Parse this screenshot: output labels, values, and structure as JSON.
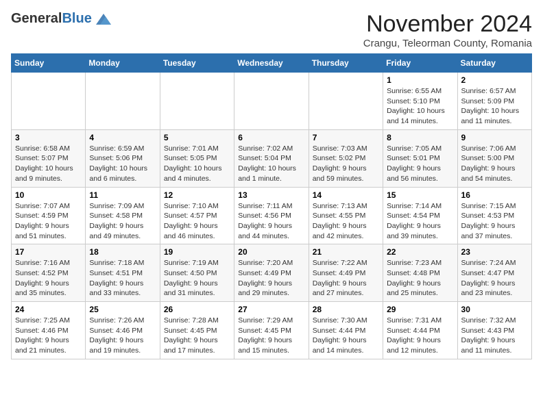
{
  "header": {
    "logo_general": "General",
    "logo_blue": "Blue",
    "month_title": "November 2024",
    "location": "Crangu, Teleorman County, Romania"
  },
  "days_of_week": [
    "Sunday",
    "Monday",
    "Tuesday",
    "Wednesday",
    "Thursday",
    "Friday",
    "Saturday"
  ],
  "weeks": [
    [
      {
        "day": "",
        "info": ""
      },
      {
        "day": "",
        "info": ""
      },
      {
        "day": "",
        "info": ""
      },
      {
        "day": "",
        "info": ""
      },
      {
        "day": "",
        "info": ""
      },
      {
        "day": "1",
        "info": "Sunrise: 6:55 AM\nSunset: 5:10 PM\nDaylight: 10 hours and 14 minutes."
      },
      {
        "day": "2",
        "info": "Sunrise: 6:57 AM\nSunset: 5:09 PM\nDaylight: 10 hours and 11 minutes."
      }
    ],
    [
      {
        "day": "3",
        "info": "Sunrise: 6:58 AM\nSunset: 5:07 PM\nDaylight: 10 hours and 9 minutes."
      },
      {
        "day": "4",
        "info": "Sunrise: 6:59 AM\nSunset: 5:06 PM\nDaylight: 10 hours and 6 minutes."
      },
      {
        "day": "5",
        "info": "Sunrise: 7:01 AM\nSunset: 5:05 PM\nDaylight: 10 hours and 4 minutes."
      },
      {
        "day": "6",
        "info": "Sunrise: 7:02 AM\nSunset: 5:04 PM\nDaylight: 10 hours and 1 minute."
      },
      {
        "day": "7",
        "info": "Sunrise: 7:03 AM\nSunset: 5:02 PM\nDaylight: 9 hours and 59 minutes."
      },
      {
        "day": "8",
        "info": "Sunrise: 7:05 AM\nSunset: 5:01 PM\nDaylight: 9 hours and 56 minutes."
      },
      {
        "day": "9",
        "info": "Sunrise: 7:06 AM\nSunset: 5:00 PM\nDaylight: 9 hours and 54 minutes."
      }
    ],
    [
      {
        "day": "10",
        "info": "Sunrise: 7:07 AM\nSunset: 4:59 PM\nDaylight: 9 hours and 51 minutes."
      },
      {
        "day": "11",
        "info": "Sunrise: 7:09 AM\nSunset: 4:58 PM\nDaylight: 9 hours and 49 minutes."
      },
      {
        "day": "12",
        "info": "Sunrise: 7:10 AM\nSunset: 4:57 PM\nDaylight: 9 hours and 46 minutes."
      },
      {
        "day": "13",
        "info": "Sunrise: 7:11 AM\nSunset: 4:56 PM\nDaylight: 9 hours and 44 minutes."
      },
      {
        "day": "14",
        "info": "Sunrise: 7:13 AM\nSunset: 4:55 PM\nDaylight: 9 hours and 42 minutes."
      },
      {
        "day": "15",
        "info": "Sunrise: 7:14 AM\nSunset: 4:54 PM\nDaylight: 9 hours and 39 minutes."
      },
      {
        "day": "16",
        "info": "Sunrise: 7:15 AM\nSunset: 4:53 PM\nDaylight: 9 hours and 37 minutes."
      }
    ],
    [
      {
        "day": "17",
        "info": "Sunrise: 7:16 AM\nSunset: 4:52 PM\nDaylight: 9 hours and 35 minutes."
      },
      {
        "day": "18",
        "info": "Sunrise: 7:18 AM\nSunset: 4:51 PM\nDaylight: 9 hours and 33 minutes."
      },
      {
        "day": "19",
        "info": "Sunrise: 7:19 AM\nSunset: 4:50 PM\nDaylight: 9 hours and 31 minutes."
      },
      {
        "day": "20",
        "info": "Sunrise: 7:20 AM\nSunset: 4:49 PM\nDaylight: 9 hours and 29 minutes."
      },
      {
        "day": "21",
        "info": "Sunrise: 7:22 AM\nSunset: 4:49 PM\nDaylight: 9 hours and 27 minutes."
      },
      {
        "day": "22",
        "info": "Sunrise: 7:23 AM\nSunset: 4:48 PM\nDaylight: 9 hours and 25 minutes."
      },
      {
        "day": "23",
        "info": "Sunrise: 7:24 AM\nSunset: 4:47 PM\nDaylight: 9 hours and 23 minutes."
      }
    ],
    [
      {
        "day": "24",
        "info": "Sunrise: 7:25 AM\nSunset: 4:46 PM\nDaylight: 9 hours and 21 minutes."
      },
      {
        "day": "25",
        "info": "Sunrise: 7:26 AM\nSunset: 4:46 PM\nDaylight: 9 hours and 19 minutes."
      },
      {
        "day": "26",
        "info": "Sunrise: 7:28 AM\nSunset: 4:45 PM\nDaylight: 9 hours and 17 minutes."
      },
      {
        "day": "27",
        "info": "Sunrise: 7:29 AM\nSunset: 4:45 PM\nDaylight: 9 hours and 15 minutes."
      },
      {
        "day": "28",
        "info": "Sunrise: 7:30 AM\nSunset: 4:44 PM\nDaylight: 9 hours and 14 minutes."
      },
      {
        "day": "29",
        "info": "Sunrise: 7:31 AM\nSunset: 4:44 PM\nDaylight: 9 hours and 12 minutes."
      },
      {
        "day": "30",
        "info": "Sunrise: 7:32 AM\nSunset: 4:43 PM\nDaylight: 9 hours and 11 minutes."
      }
    ]
  ]
}
